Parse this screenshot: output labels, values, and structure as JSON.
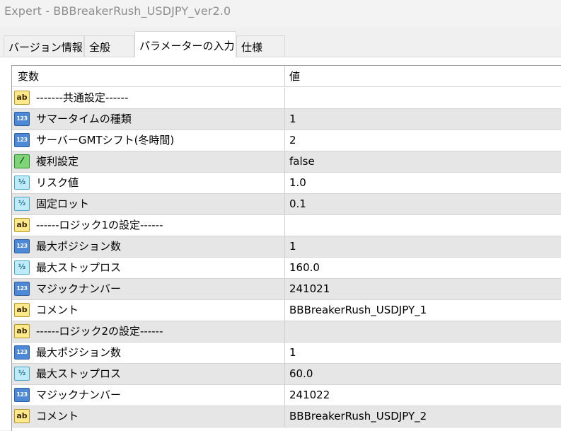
{
  "window": {
    "title": "Expert - BBBreakerRush_USDJPY_ver2.0"
  },
  "tabs": [
    {
      "label": "バージョン情報",
      "active": false
    },
    {
      "label": "全般",
      "active": false
    },
    {
      "label": "パラメーターの入力",
      "active": true
    },
    {
      "label": "仕様",
      "active": false
    }
  ],
  "table": {
    "columns": {
      "name": "変数",
      "value": "値"
    },
    "rows": [
      {
        "icon": "string-icon",
        "glyph": "ab",
        "name": "-------共通設定------",
        "value": ""
      },
      {
        "icon": "integer-icon",
        "glyph": "123",
        "name": "サマータイムの種類",
        "value": "1"
      },
      {
        "icon": "integer-icon",
        "glyph": "123",
        "name": "サーバーGMTシフト(冬時間)",
        "value": "2"
      },
      {
        "icon": "boolean-icon",
        "glyph": "⁄",
        "name": "複利設定",
        "value": "false"
      },
      {
        "icon": "double-icon",
        "glyph": "½",
        "name": "リスク値",
        "value": "1.0"
      },
      {
        "icon": "double-icon",
        "glyph": "½",
        "name": "固定ロット",
        "value": "0.1"
      },
      {
        "icon": "string-icon",
        "glyph": "ab",
        "name": "------ロジック1の設定------",
        "value": ""
      },
      {
        "icon": "integer-icon",
        "glyph": "123",
        "name": "最大ポジション数",
        "value": "1"
      },
      {
        "icon": "double-icon",
        "glyph": "½",
        "name": "最大ストップロス",
        "value": "160.0"
      },
      {
        "icon": "integer-icon",
        "glyph": "123",
        "name": "マジックナンバー",
        "value": "241021"
      },
      {
        "icon": "string-icon",
        "glyph": "ab",
        "name": "コメント",
        "value": "BBBreakerRush_USDJPY_1"
      },
      {
        "icon": "string-icon",
        "glyph": "ab",
        "name": "------ロジック2の設定------",
        "value": ""
      },
      {
        "icon": "integer-icon",
        "glyph": "123",
        "name": "最大ポジション数",
        "value": "1"
      },
      {
        "icon": "double-icon",
        "glyph": "½",
        "name": "最大ストップロス",
        "value": "60.0"
      },
      {
        "icon": "integer-icon",
        "glyph": "123",
        "name": "マジックナンバー",
        "value": "241022"
      },
      {
        "icon": "string-icon",
        "glyph": "ab",
        "name": "コメント",
        "value": "BBBreakerRush_USDJPY_2"
      }
    ]
  }
}
